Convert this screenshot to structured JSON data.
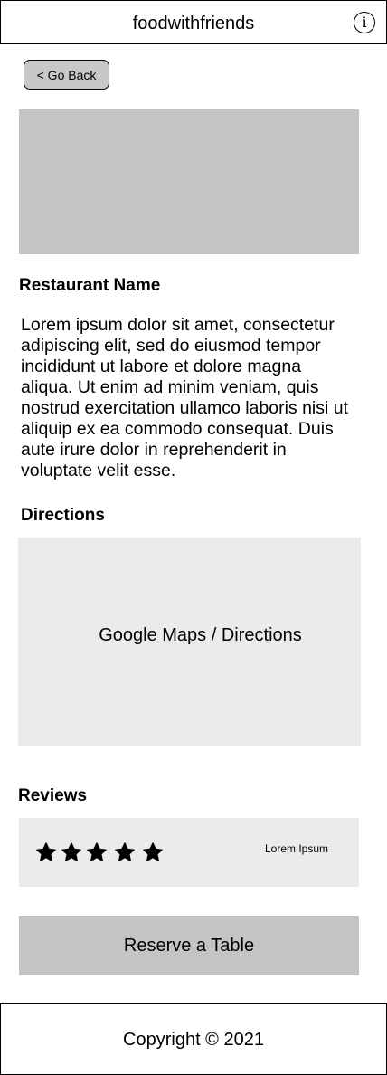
{
  "header": {
    "title": "foodwithfriends",
    "info_icon": "info-icon",
    "info_glyph": "i"
  },
  "nav": {
    "back_label": "< Go Back"
  },
  "restaurant": {
    "name": "Restaurant Name",
    "description": "Lorem ipsum dolor sit amet, consectetur adipiscing elit, sed do eiusmod tempor incididunt ut labore et dolore magna aliqua. Ut enim ad minim veniam, quis nostrud exercitation ullamco laboris nisi ut aliquip ex ea commodo consequat. Duis aute irure dolor in reprehenderit in voluptate velit esse."
  },
  "directions": {
    "heading": "Directions",
    "map_label": "Google Maps / Directions"
  },
  "reviews": {
    "heading": "Reviews",
    "rating": 5,
    "rating_max": 5,
    "star_icon": "star-icon",
    "text": "Lorem Ipsum"
  },
  "actions": {
    "reserve_label": "Reserve a Table"
  },
  "footer": {
    "copyright": "Copyright © 2021"
  },
  "colors": {
    "placeholder_dark": "#c4c4c4",
    "placeholder_light": "#ebebeb",
    "button": "#c8c8c8",
    "border": "#000000"
  }
}
